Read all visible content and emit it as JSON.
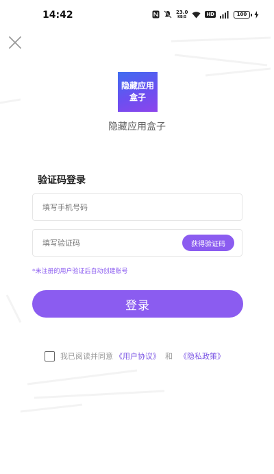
{
  "status_bar": {
    "time": "14:42",
    "net_speed_value": "23.0",
    "net_speed_unit": "KB/S",
    "hd_label": "HD",
    "battery_level": "100",
    "icons": [
      "nfc-icon",
      "mute-icon",
      "wifi-icon",
      "signal-icon",
      "charging-icon"
    ]
  },
  "app": {
    "icon_text_line1": "隐藏应用",
    "icon_text_line2": "盒子",
    "name": "隐藏应用盒子",
    "icon_colors": [
      "#3f6df0",
      "#8d45ec"
    ]
  },
  "login": {
    "title": "验证码登录",
    "phone_placeholder": "填写手机号码",
    "code_placeholder": "填写验证码",
    "get_code_label": "获得验证码",
    "hint": "*未注册的用户验证后自动创建账号",
    "submit_label": "登录"
  },
  "agreement": {
    "text": "我已阅读并同意",
    "user_agreement": "《用户协议》",
    "and": "和",
    "privacy_policy": "《隐私政策》",
    "checked": false
  },
  "colors": {
    "accent": "#8b5cf0",
    "link": "#7a54e4"
  }
}
